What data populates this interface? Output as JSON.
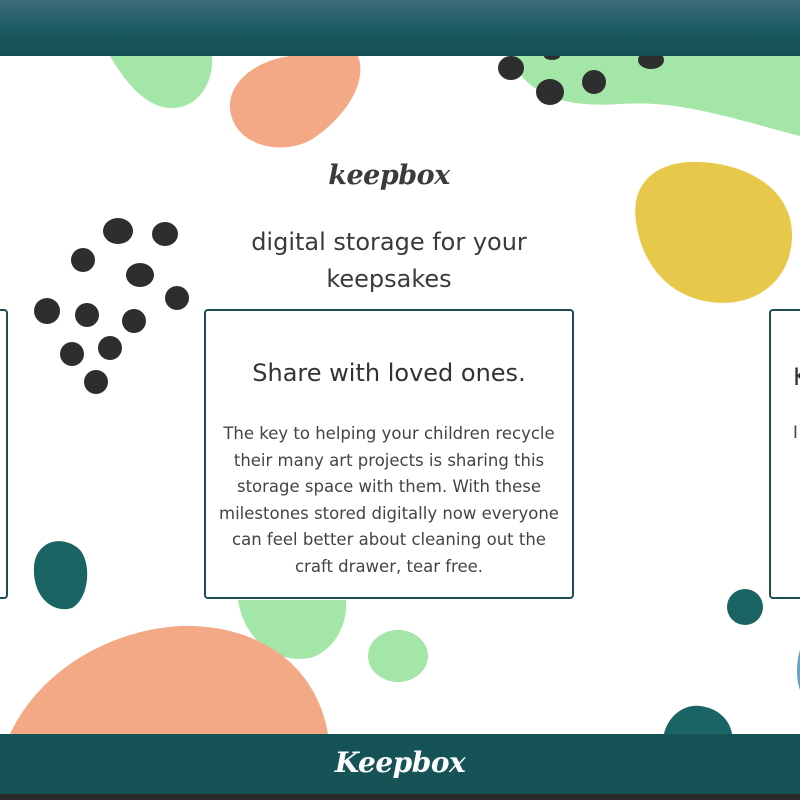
{
  "brand": {
    "logo_text": "keepbox",
    "tagline": "digital storage for your keepsakes"
  },
  "cards": [
    {
      "title": "Share with loved ones.",
      "body": "The key to helping your children recycle their many art projects is sharing this storage space with them. With these milestones stored digitally now everyone can feel better about cleaning out the craft drawer, tear free."
    },
    {
      "title_peek": "K",
      "body_peek": "I"
    }
  ],
  "footer": {
    "logo_text": "Keepbox"
  },
  "colors": {
    "header": "#1b5a60",
    "footer": "#165357",
    "card_border": "#1e4f55",
    "blob_green": "#a3e6a8",
    "blob_salmon": "#f3a886",
    "blob_yellow": "#e8c84a",
    "blob_teal": "#1a6464",
    "dots": "#2e2e2e"
  }
}
